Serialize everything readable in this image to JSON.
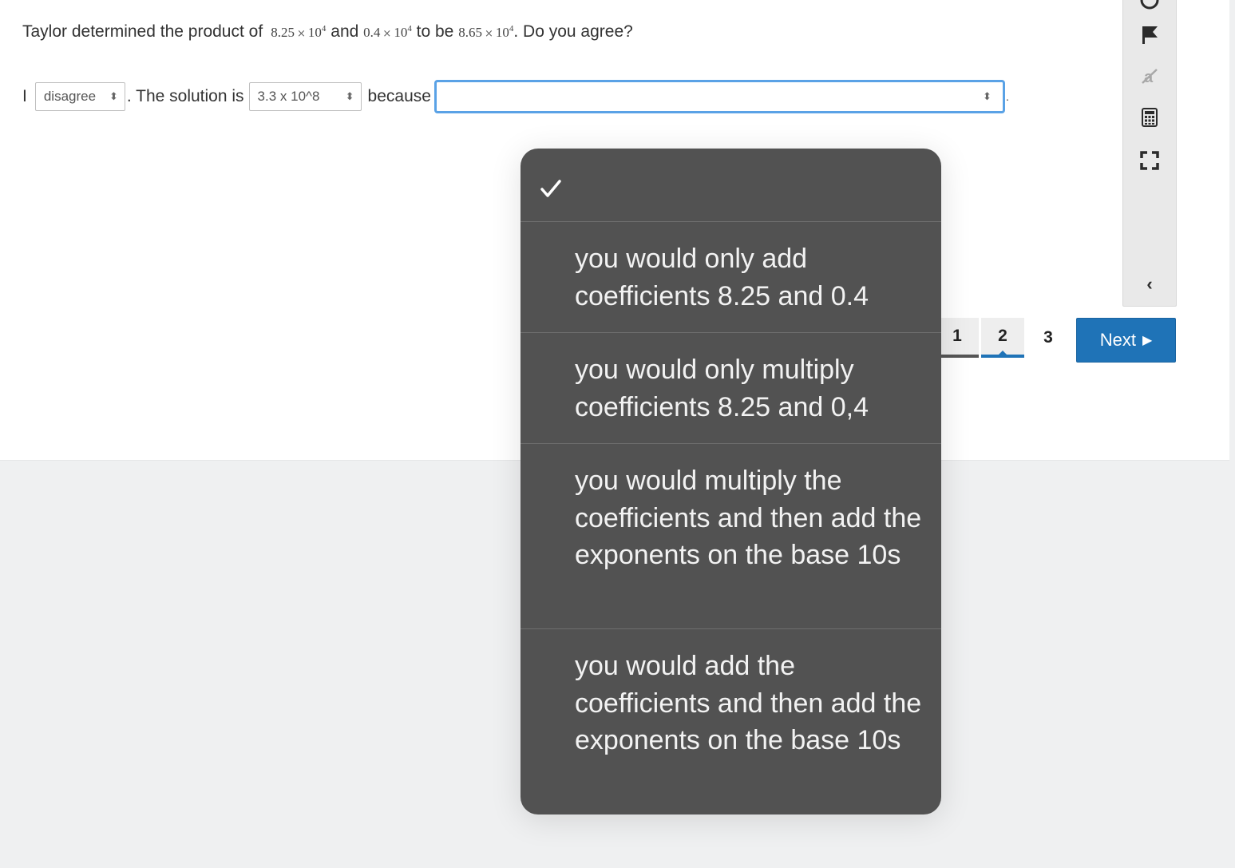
{
  "question": {
    "prefix": "Taylor determined the product of",
    "term1": {
      "coefficient": "8.25",
      "base": "10",
      "exponent": "4"
    },
    "joiner1": "and",
    "term2": {
      "coefficient": "0.4",
      "base": "10",
      "exponent": "4"
    },
    "joiner2": "to be",
    "term3": {
      "coefficient": "8.65",
      "base": "10",
      "exponent": "4"
    },
    "suffix": ". Do you agree?"
  },
  "answer": {
    "lead": "I",
    "agree_select": {
      "value": "disagree"
    },
    "mid": ". The solution is",
    "solution_select": {
      "value": "3.3 x 10^8"
    },
    "because_label": "because",
    "because_select": {
      "value": ""
    },
    "end": "."
  },
  "sidebar": {
    "icons": [
      "timer-icon",
      "flag-icon",
      "strikethrough-icon",
      "calculator-icon",
      "fullscreen-icon"
    ],
    "collapse_label": "‹"
  },
  "pager": {
    "pages": [
      {
        "label": "1",
        "state": "visited"
      },
      {
        "label": "2",
        "state": "current"
      },
      {
        "label": "3",
        "state": "unvisited"
      }
    ],
    "next_label": "Next"
  },
  "dropdown": {
    "selected_index": 0,
    "options": [
      "",
      "you would only add coefficients 8.25 and 0.4",
      "you would only multiply coefficients 8.25 and 0,4",
      "you would multiply the coefficients and then add the exponents on the base 10s",
      "you would add the coefficients and then add the exponents on the base 10s"
    ]
  },
  "colors": {
    "accent": "#1f73b7",
    "focus_ring": "#5aa2e6",
    "dropdown_bg": "#525252"
  }
}
